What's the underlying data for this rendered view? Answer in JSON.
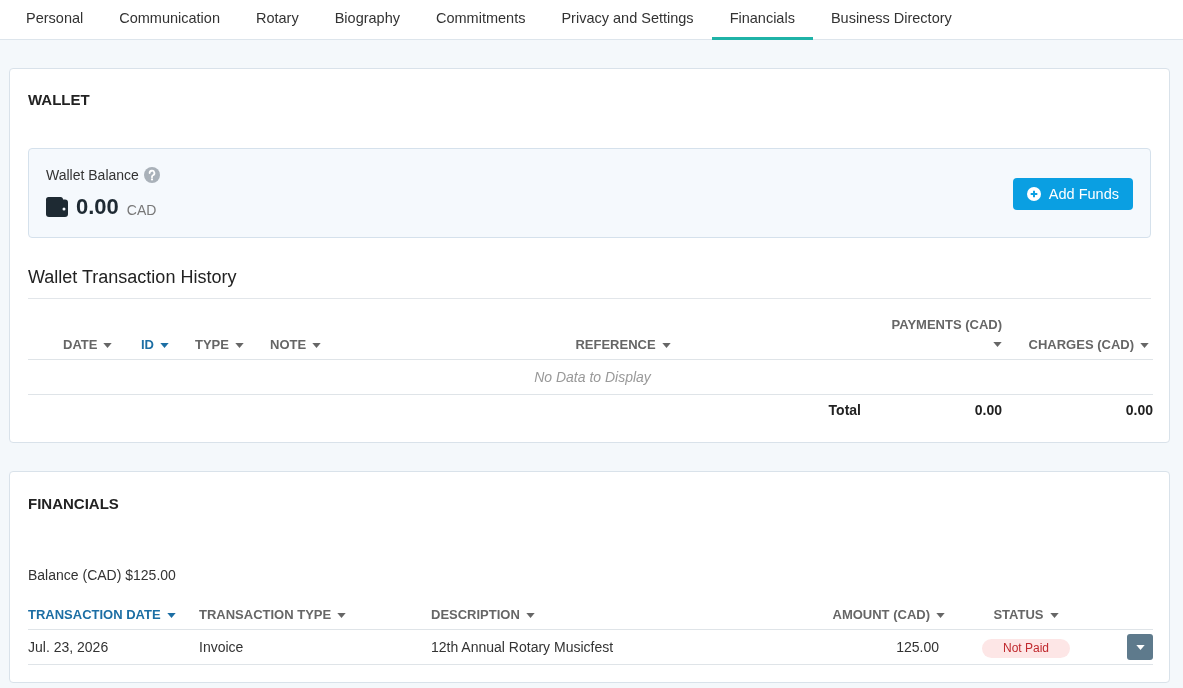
{
  "tabs": [
    {
      "label": "Personal",
      "selected": false
    },
    {
      "label": "Communication",
      "selected": false
    },
    {
      "label": "Rotary",
      "selected": false
    },
    {
      "label": "Biography",
      "selected": false
    },
    {
      "label": "Commitments",
      "selected": false
    },
    {
      "label": "Privacy and Settings",
      "selected": false
    },
    {
      "label": "Financials",
      "selected": true
    },
    {
      "label": "Business Directory",
      "selected": false
    }
  ],
  "wallet": {
    "title": "WALLET",
    "balance_label": "Wallet Balance",
    "balance": "0.00",
    "currency": "CAD",
    "add_funds_button": "Add Funds",
    "history_title": "Wallet Transaction History",
    "table": {
      "columns": [
        {
          "label": "DATE",
          "sorted": false
        },
        {
          "label": "ID",
          "sorted": true
        },
        {
          "label": "TYPE",
          "sorted": false
        },
        {
          "label": "NOTE",
          "sorted": false
        },
        {
          "label": "REFERENCE",
          "sorted": false
        },
        {
          "label": "PAYMENTS (CAD)",
          "sorted": false
        },
        {
          "label": "CHARGES (CAD)",
          "sorted": false
        }
      ],
      "empty_message": "No Data to Display",
      "total_label": "Total",
      "totals": [
        "0.00",
        "0.00"
      ]
    }
  },
  "financials": {
    "title": "FINANCIALS",
    "balance": "Balance (CAD) $125.00",
    "table": {
      "columns": [
        {
          "label": "TRANSACTION DATE",
          "sorted": true
        },
        {
          "label": "TRANSACTION TYPE",
          "sorted": false
        },
        {
          "label": "DESCRIPTION",
          "sorted": false
        },
        {
          "label": "AMOUNT (CAD)",
          "sorted": false
        },
        {
          "label": "STATUS",
          "sorted": false
        }
      ],
      "rows": [
        {
          "cells": [
            "Jul. 23, 2026",
            "Invoice",
            "12th Annual Rotary Musicfest",
            "125.00"
          ],
          "status": "Not Paid"
        }
      ]
    }
  }
}
